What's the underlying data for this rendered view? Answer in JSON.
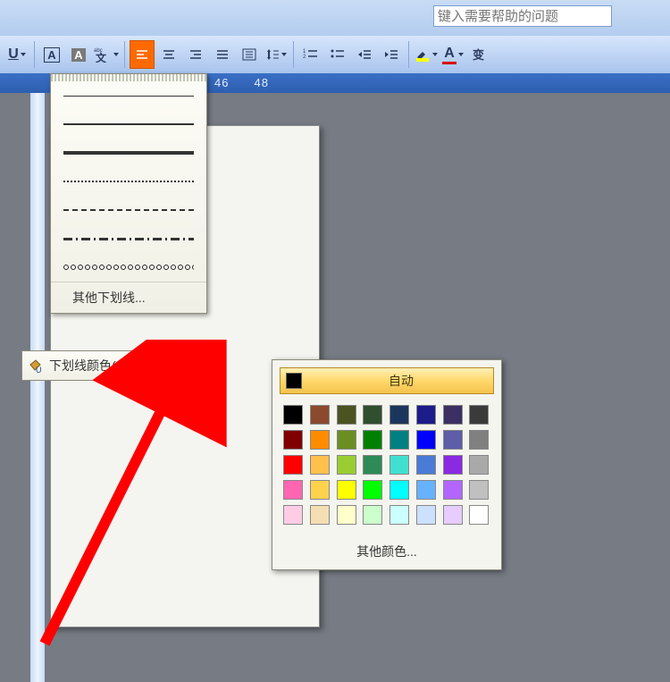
{
  "help_placeholder": "键入需要帮助的问题",
  "ruler": {
    "marks": [
      "46",
      "48"
    ]
  },
  "underline_menu": {
    "more_label": "其他下划线...",
    "color_label": "下划线颜色(U)"
  },
  "color_flyout": {
    "auto_label": "自动",
    "more_label": "其他颜色...",
    "swatches": [
      "#000000",
      "#8b4a2d",
      "#4b5320",
      "#2f4f2f",
      "#1b365d",
      "#1c1c8a",
      "#3b2f63",
      "#3a3a3a",
      "#800000",
      "#ff8c00",
      "#6b8e23",
      "#008000",
      "#008080",
      "#0000ff",
      "#5d5da8",
      "#808080",
      "#ff0000",
      "#ffc04c",
      "#9acd32",
      "#2e8b57",
      "#40e0d0",
      "#4a7bd6",
      "#8a2be2",
      "#a9a9a9",
      "#ff66b2",
      "#ffd24d",
      "#ffff00",
      "#00ff00",
      "#00ffff",
      "#66b2ff",
      "#b266ff",
      "#c0c0c0",
      "#ffcce5",
      "#f5deb3",
      "#ffffcc",
      "#ccffcc",
      "#ccffff",
      "#cce0ff",
      "#e6ccff",
      "#ffffff"
    ]
  }
}
